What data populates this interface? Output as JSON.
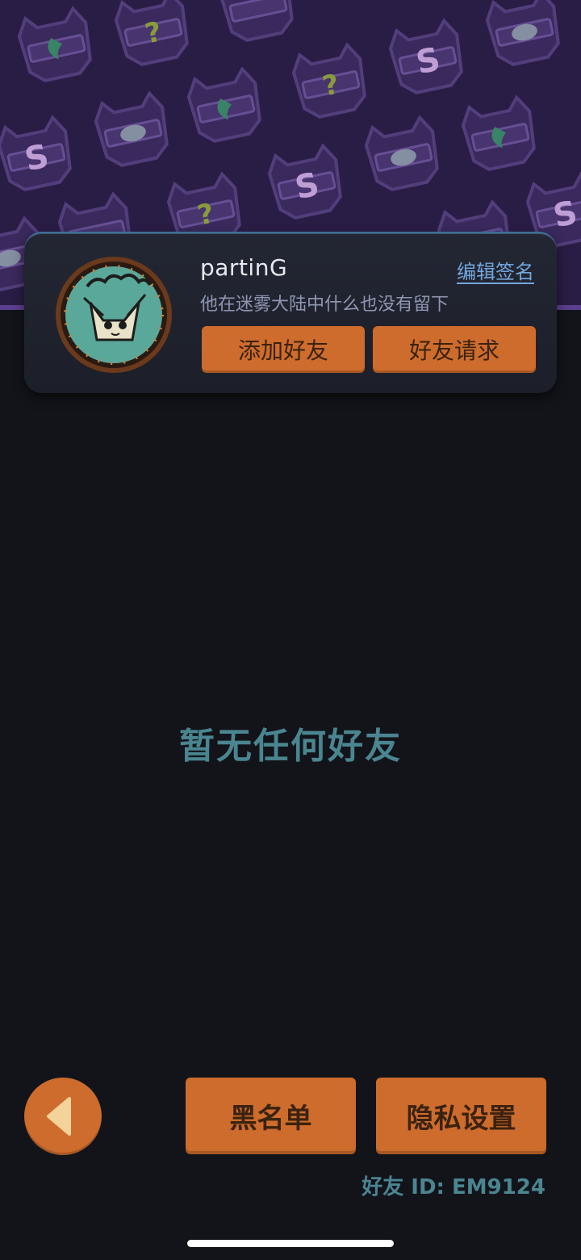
{
  "profile": {
    "username": "partinG",
    "edit_signature_label": "编辑签名",
    "signature": "他在迷雾大陆中什么也没有留下",
    "add_friend_label": "添加好友",
    "friend_request_label": "好友请求"
  },
  "empty_state": {
    "message": "暂无任何好友"
  },
  "bottom": {
    "blacklist_label": "黑名单",
    "privacy_label": "隐私设置",
    "friend_id": "好友 ID: EM9124"
  },
  "icons": {
    "back": "back-triangle-icon",
    "avatar": "cat-avatar-icon"
  },
  "colors": {
    "background": "#12141a",
    "banner": "#2a1d45",
    "button_orange": "#cd6c2c",
    "teal_text": "#4a8590",
    "link_blue": "#72a6dc"
  }
}
